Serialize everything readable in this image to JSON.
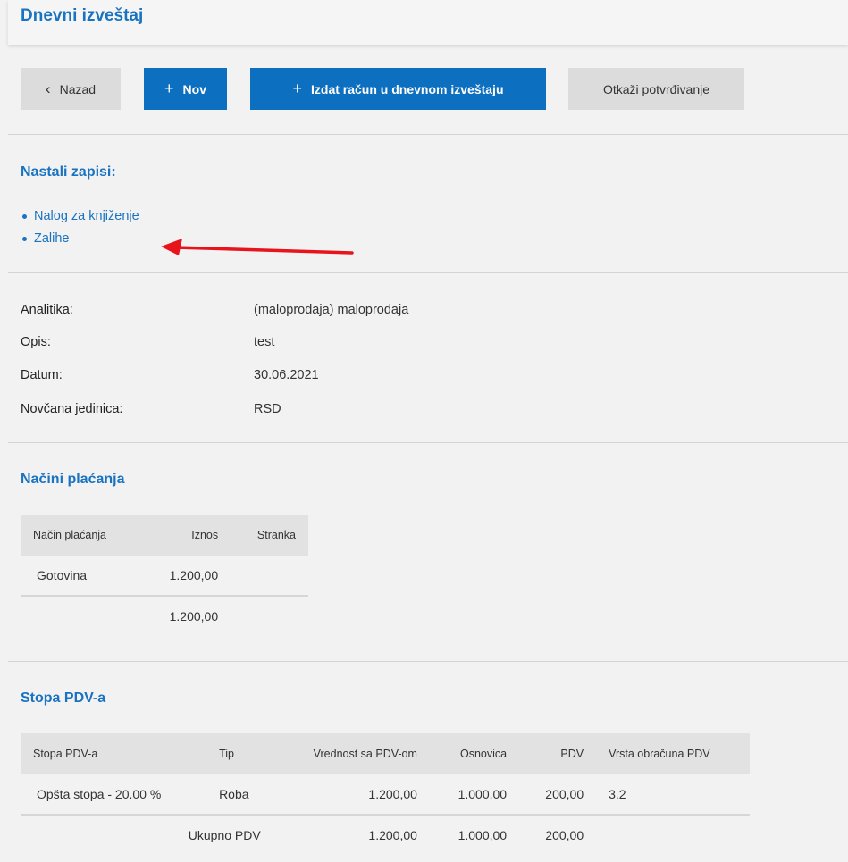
{
  "header": {
    "title": "Dnevni izveštaj"
  },
  "toolbar": {
    "back_label": "Nazad",
    "new_label": "Nov",
    "issue_label": "Izdat račun u dnevnom izveštaju",
    "cancel_label": "Otkaži potvrđivanje"
  },
  "records": {
    "title": "Nastali zapisi:",
    "links": [
      "Nalog za knjiženje",
      "Zalihe"
    ]
  },
  "info": {
    "analytics_label": "Analitika:",
    "analytics_value": "(maloprodaja) maloprodaja",
    "desc_label": "Opis:",
    "desc_value": "test",
    "date_label": "Datum:",
    "date_value": "30.06.2021",
    "currency_label": "Novčana jedinica:",
    "currency_value": "RSD"
  },
  "payments": {
    "title": "Načini plaćanja",
    "columns": [
      "Način plaćanja",
      "Iznos",
      "Stranka"
    ],
    "rows": [
      [
        "Gotovina",
        "1.200,00",
        ""
      ]
    ],
    "total": "1.200,00"
  },
  "vat": {
    "title": "Stopa PDV-a",
    "columns": [
      "Stopa PDV-a",
      "Tip",
      "Vrednost sa PDV-om",
      "Osnovica",
      "PDV",
      "Vrsta obračuna PDV"
    ],
    "rows": [
      [
        "Opšta stopa - 20.00 %",
        "Roba",
        "1.200,00",
        "1.000,00",
        "200,00",
        "3.2"
      ]
    ],
    "total_label": "Ukupno PDV",
    "total": [
      "1.200,00",
      "1.000,00",
      "200,00"
    ]
  },
  "colors": {
    "accent": "#1a73c0",
    "button_blue": "#0d6fbf",
    "arrow": "#e8141b"
  }
}
